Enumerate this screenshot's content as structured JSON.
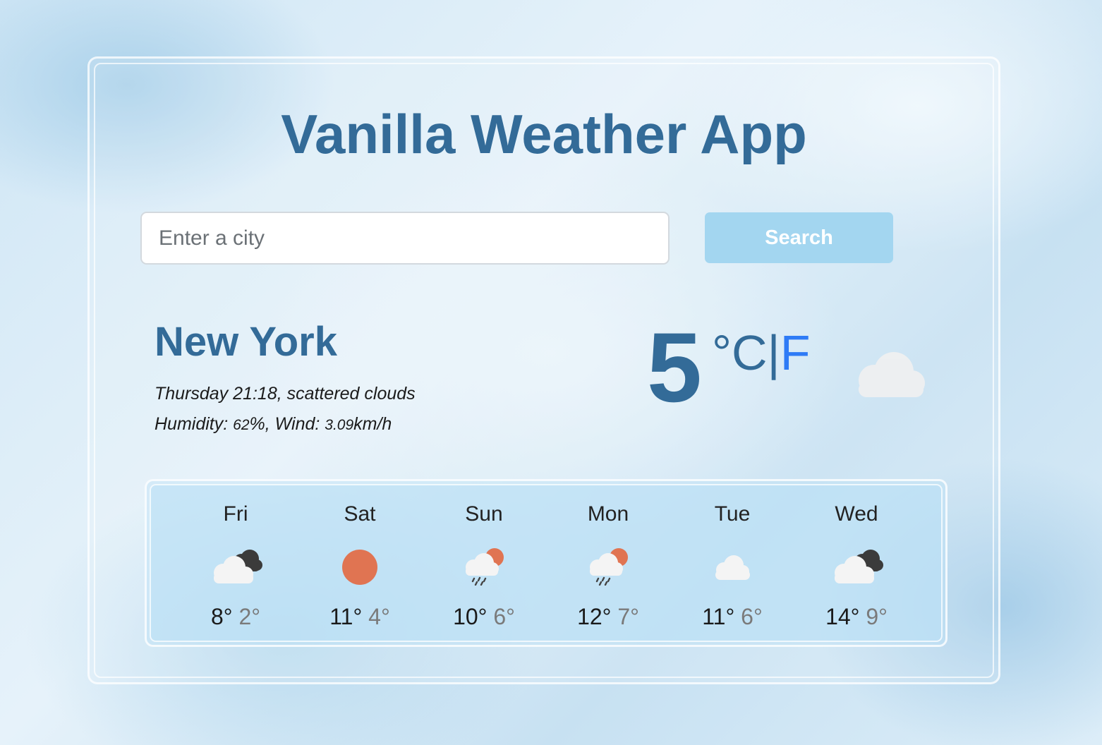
{
  "app": {
    "title": "Vanilla Weather App"
  },
  "search": {
    "placeholder": "Enter a city",
    "value": "",
    "button_label": "Search"
  },
  "current": {
    "city": "New York",
    "day_time": "Thursday 21:18",
    "description": "scattered clouds",
    "humidity_label": "Humidity:",
    "humidity_value": "62",
    "humidity_unit": "%",
    "wind_label": "Wind:",
    "wind_value": "3.09",
    "wind_unit": "km/h",
    "temperature": "5",
    "unit_celsius": "°C",
    "unit_separator": "|",
    "unit_fahrenheit": "F",
    "icon": "cloud-icon"
  },
  "forecast": [
    {
      "day": "Fri",
      "icon": "cloud-with-dark-cloud-icon",
      "max": "8°",
      "min": "2°"
    },
    {
      "day": "Sat",
      "icon": "sun-icon",
      "max": "11°",
      "min": "4°"
    },
    {
      "day": "Sun",
      "icon": "rain-cloud-sun-icon",
      "max": "10°",
      "min": "6°"
    },
    {
      "day": "Mon",
      "icon": "rain-cloud-sun-icon",
      "max": "12°",
      "min": "7°"
    },
    {
      "day": "Tue",
      "icon": "cloud-icon",
      "max": "11°",
      "min": "6°"
    },
    {
      "day": "Wed",
      "icon": "cloud-with-dark-cloud-icon",
      "max": "14°",
      "min": "9°"
    }
  ],
  "colors": {
    "title": "#336b98",
    "search_button": "#a3d6f0",
    "fahrenheit_link": "#2e7bf6",
    "sun": "#e07452"
  }
}
